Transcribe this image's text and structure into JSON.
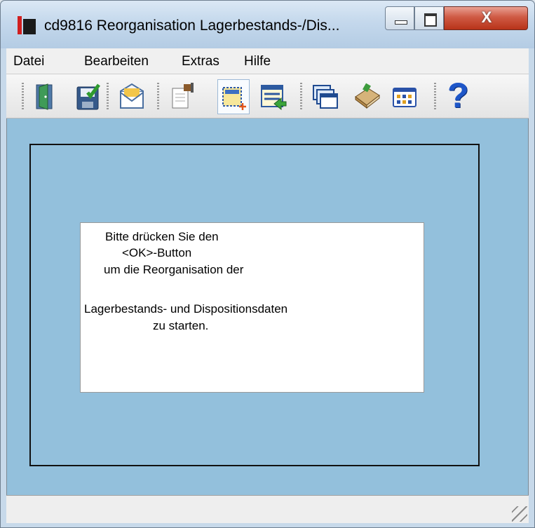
{
  "window": {
    "title": "cd9816 Reorganisation Lagerbestands-/Dis...",
    "close_glyph": "X"
  },
  "menu": {
    "items": [
      "Datei",
      "Bearbeiten",
      "Extras",
      "Hilfe"
    ]
  },
  "toolbar": {
    "buttons": [
      {
        "icon": "exit-door-icon"
      },
      {
        "icon": "save-disk-icon"
      },
      {
        "icon": "mail-envelope-icon"
      },
      {
        "icon": "edit-document-icon"
      },
      {
        "icon": "new-record-icon"
      },
      {
        "icon": "list-transfer-icon"
      },
      {
        "icon": "windows-stack-icon"
      },
      {
        "icon": "book-icon"
      },
      {
        "icon": "grid-view-icon"
      },
      {
        "icon": "help-icon",
        "glyph": "?"
      }
    ]
  },
  "message": {
    "lines": [
      "Bitte drücken Sie den",
      "<OK>-Button",
      "um die Reorganisation der",
      "Lagerbestands- und Dispositionsdaten",
      "zu starten."
    ]
  },
  "colors": {
    "client_background": "#93c0dc",
    "titlebar": "#c4d8ec",
    "close_button": "#cf5a44"
  }
}
